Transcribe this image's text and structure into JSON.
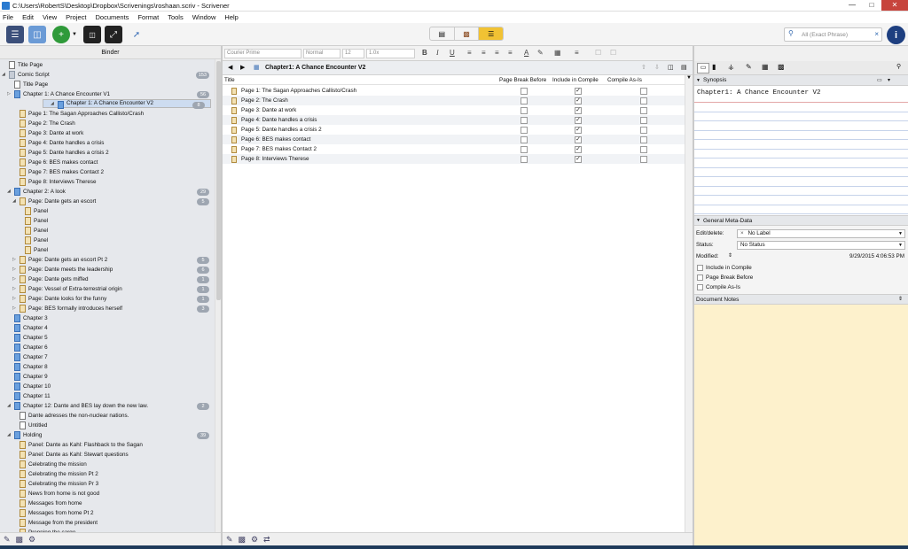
{
  "window": {
    "title": "C:\\Users\\RobertS\\Desktop\\Dropbox\\Scrivenings\\roshaan.scriv - Scrivener"
  },
  "menu": [
    "File",
    "Edit",
    "View",
    "Project",
    "Documents",
    "Format",
    "Tools",
    "Window",
    "Help"
  ],
  "toolbar": {
    "search_placeholder": "All (Exact Phrase)"
  },
  "format_bar": {
    "font": "Courier Prime",
    "style": "Normal",
    "size": "12",
    "spacing": "1.0x"
  },
  "binder": {
    "title": "Binder",
    "items": [
      {
        "label": "Title Page",
        "level": 0,
        "icon": "txt",
        "twisty": ""
      },
      {
        "label": "Comic Script",
        "level": 0,
        "icon": "fol",
        "twisty": "◢",
        "badge": "153"
      },
      {
        "label": "Title Page",
        "level": 1,
        "icon": "txt",
        "twisty": ""
      },
      {
        "label": "Chapter 1: A Chance Encounter V1",
        "level": 1,
        "icon": "blue",
        "twisty": "▷",
        "badge": "56"
      },
      {
        "label": "Chapter 1: A Chance Encounter V2",
        "level": 1,
        "icon": "blue",
        "twisty": "◢",
        "badge": "8",
        "selected": true
      },
      {
        "label": "Page 1: The Sagan Approaches Callisto/Crash",
        "level": 2,
        "icon": "doc",
        "twisty": ""
      },
      {
        "label": "Page 2: The Crash",
        "level": 2,
        "icon": "doc",
        "twisty": ""
      },
      {
        "label": "Page 3: Dante at work",
        "level": 2,
        "icon": "doc",
        "twisty": ""
      },
      {
        "label": "Page 4: Dante handles a crisis",
        "level": 2,
        "icon": "doc",
        "twisty": ""
      },
      {
        "label": "Page 5: Dante handles a crisis 2",
        "level": 2,
        "icon": "doc",
        "twisty": ""
      },
      {
        "label": "Page 6: BES makes contact",
        "level": 2,
        "icon": "doc",
        "twisty": ""
      },
      {
        "label": "Page 7: BES makes Contact 2",
        "level": 2,
        "icon": "doc",
        "twisty": ""
      },
      {
        "label": "Page 8: Interviews Therese",
        "level": 2,
        "icon": "doc",
        "twisty": ""
      },
      {
        "label": "Chapter 2: A look",
        "level": 1,
        "icon": "blue",
        "twisty": "◢",
        "badge": "29"
      },
      {
        "label": "Page: Dante gets an escort",
        "level": 2,
        "icon": "doc",
        "twisty": "◢",
        "badge": "5"
      },
      {
        "label": "Panel",
        "level": 3,
        "icon": "doc",
        "twisty": ""
      },
      {
        "label": "Panel",
        "level": 3,
        "icon": "doc",
        "twisty": ""
      },
      {
        "label": "Panel",
        "level": 3,
        "icon": "doc",
        "twisty": ""
      },
      {
        "label": "Panel",
        "level": 3,
        "icon": "doc",
        "twisty": ""
      },
      {
        "label": "Panel",
        "level": 3,
        "icon": "doc",
        "twisty": ""
      },
      {
        "label": "Page: Dante gets an escort Pt 2",
        "level": 2,
        "icon": "doc",
        "twisty": "▷",
        "badge": "5"
      },
      {
        "label": "Page: Dante meets the leadership",
        "level": 2,
        "icon": "doc",
        "twisty": "▷",
        "badge": "6"
      },
      {
        "label": "Page: Dante gets miffed",
        "level": 2,
        "icon": "doc",
        "twisty": "▷",
        "badge": "1"
      },
      {
        "label": "Page: Vessel of Extra-terrestrial origin",
        "level": 2,
        "icon": "doc",
        "twisty": "▷",
        "badge": "1"
      },
      {
        "label": "Page: Dante looks for the funny",
        "level": 2,
        "icon": "doc",
        "twisty": "▷",
        "badge": "1"
      },
      {
        "label": "Page: BES formally introduces herself",
        "level": 2,
        "icon": "doc",
        "twisty": "▷",
        "badge": "3"
      },
      {
        "label": "Chapter 3",
        "level": 1,
        "icon": "blue",
        "twisty": ""
      },
      {
        "label": "Chapter 4",
        "level": 1,
        "icon": "blue",
        "twisty": ""
      },
      {
        "label": "Chapter 5",
        "level": 1,
        "icon": "blue",
        "twisty": ""
      },
      {
        "label": "Chapter 6",
        "level": 1,
        "icon": "blue",
        "twisty": ""
      },
      {
        "label": "Chapter 7",
        "level": 1,
        "icon": "blue",
        "twisty": ""
      },
      {
        "label": "Chapter 8",
        "level": 1,
        "icon": "blue",
        "twisty": ""
      },
      {
        "label": "Chapter 9",
        "level": 1,
        "icon": "blue",
        "twisty": ""
      },
      {
        "label": "Chapter 10",
        "level": 1,
        "icon": "blue",
        "twisty": ""
      },
      {
        "label": "Chapter 11",
        "level": 1,
        "icon": "blue",
        "twisty": ""
      },
      {
        "label": "Chapter 12: Dante and BES lay down the new law.",
        "level": 1,
        "icon": "blue",
        "twisty": "◢",
        "badge": "2"
      },
      {
        "label": "Dante adresses the non-nuclear nations.",
        "level": 2,
        "icon": "txt",
        "twisty": ""
      },
      {
        "label": "Untitled",
        "level": 2,
        "icon": "txt",
        "twisty": ""
      },
      {
        "label": "Holding",
        "level": 1,
        "icon": "blue",
        "twisty": "◢",
        "badge": "39"
      },
      {
        "label": "Panel: Dante as Kahl: Flashback to the Sagan",
        "level": 2,
        "icon": "doc",
        "twisty": ""
      },
      {
        "label": "Panel: Dante as Kahl: Stewart questions",
        "level": 2,
        "icon": "doc",
        "twisty": ""
      },
      {
        "label": "Celebrating the mission",
        "level": 2,
        "icon": "doc",
        "twisty": ""
      },
      {
        "label": "Celebrating the mission Pt 2",
        "level": 2,
        "icon": "doc",
        "twisty": ""
      },
      {
        "label": "Celebrating the mission Pr 3",
        "level": 2,
        "icon": "doc",
        "twisty": ""
      },
      {
        "label": "News from home is not good",
        "level": 2,
        "icon": "doc",
        "twisty": ""
      },
      {
        "label": "Messages from home",
        "level": 2,
        "icon": "doc",
        "twisty": ""
      },
      {
        "label": "Messages from home Pt 2",
        "level": 2,
        "icon": "doc",
        "twisty": ""
      },
      {
        "label": "Message from the president",
        "level": 2,
        "icon": "doc",
        "twisty": ""
      },
      {
        "label": "Prepping the cargo",
        "level": 2,
        "icon": "doc",
        "twisty": ""
      }
    ]
  },
  "editor": {
    "header_title": "Chapter1: A Chance Encounter V2",
    "columns": {
      "title": "Title",
      "page_break": "Page Break Before",
      "include": "Include in Compile",
      "compile_as_is": "Compile As-Is"
    },
    "rows": [
      {
        "title": "Page 1: The Sagan Approaches Callisto/Crash",
        "page_break": false,
        "include": true,
        "as_is": false
      },
      {
        "title": "Page 2: The Crash",
        "page_break": false,
        "include": true,
        "as_is": false
      },
      {
        "title": "Page 3: Dante at work",
        "page_break": false,
        "include": true,
        "as_is": false
      },
      {
        "title": "Page 4: Dante handles a crisis",
        "page_break": false,
        "include": true,
        "as_is": false
      },
      {
        "title": "Page 5: Dante handles a crisis 2",
        "page_break": false,
        "include": true,
        "as_is": false
      },
      {
        "title": "Page 6: BES makes contact",
        "page_break": false,
        "include": true,
        "as_is": false
      },
      {
        "title": "Page 7: BES makes Contact 2",
        "page_break": false,
        "include": true,
        "as_is": false
      },
      {
        "title": "Page 8: Interviews Therese",
        "page_break": false,
        "include": true,
        "as_is": false
      }
    ]
  },
  "inspector": {
    "synopsis_label": "Synopsis",
    "synopsis_text": "Chapter1: A Chance Encounter V2",
    "meta_label": "General Meta-Data",
    "edit_delete_label": "Edit/delete:",
    "label_value": "No Label",
    "status_label": "Status:",
    "status_value": "No Status",
    "modified_label": "Modified:",
    "modified_value": "9/29/2015 4:06:53 PM",
    "include_in_compile": "Include in Compile",
    "page_break_before": "Page Break Before",
    "compile_as_is": "Compile As-Is",
    "notes_label": "Document Notes"
  }
}
